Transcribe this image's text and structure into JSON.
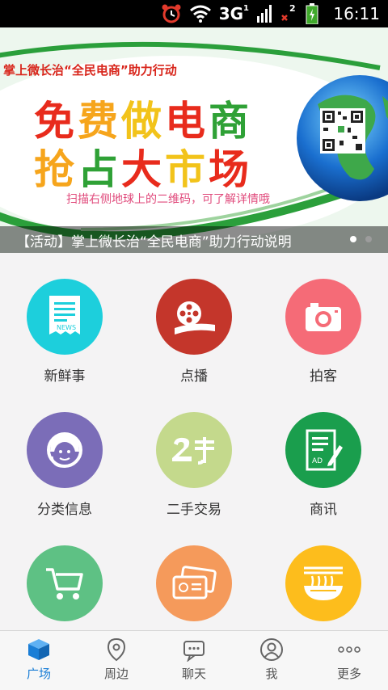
{
  "status_bar": {
    "network_label": "3G",
    "network_superscript": "1",
    "sim2_label": "2",
    "time": "16:11",
    "icons": [
      "alarm-icon",
      "wifi-icon",
      "signal-icon",
      "sim2-no-signal-icon",
      "battery-charging-icon"
    ]
  },
  "banner": {
    "top_line": "掌上微长治“全民电商”助力行动",
    "headline_1": [
      "免",
      "费",
      "做",
      "电",
      "商"
    ],
    "headline_2": [
      "抢",
      "占",
      "大",
      "市",
      "场"
    ],
    "hint": "扫描右侧地球上的二维码，可了解详情哦",
    "caption": "【活动】掌上微长治“全民电商”助力行动说明",
    "page_count": 2,
    "active_page": 1
  },
  "grid": {
    "items": [
      {
        "label": "新鲜事",
        "icon": "news-icon",
        "color": "#1dcfdc"
      },
      {
        "label": "点播",
        "icon": "film-reel-icon",
        "color": "#c4362b"
      },
      {
        "label": "拍客",
        "icon": "camera-icon",
        "color": "#f56b77"
      },
      {
        "label": "分类信息",
        "icon": "customer-service-icon",
        "color": "#7b6db8"
      },
      {
        "label": "二手交易",
        "icon": "second-hand-icon",
        "color": "#c4d98c"
      },
      {
        "label": "商讯",
        "icon": "ad-document-icon",
        "color": "#1a9e4d"
      },
      {
        "label": "",
        "icon": "shopping-cart-icon",
        "color": "#5ec184"
      },
      {
        "label": "",
        "icon": "tickets-icon",
        "color": "#f59a5b"
      },
      {
        "label": "",
        "icon": "noodle-bowl-icon",
        "color": "#fdbd1c"
      }
    ]
  },
  "nav": {
    "items": [
      {
        "label": "广场",
        "icon": "cube-icon",
        "active": true
      },
      {
        "label": "周边",
        "icon": "location-pin-icon",
        "active": false
      },
      {
        "label": "聊天",
        "icon": "chat-bubble-icon",
        "active": false
      },
      {
        "label": "我",
        "icon": "user-icon",
        "active": false
      },
      {
        "label": "更多",
        "icon": "more-icon",
        "active": false
      }
    ],
    "active_color": "#1a7ed6",
    "inactive_color": "#555555"
  }
}
